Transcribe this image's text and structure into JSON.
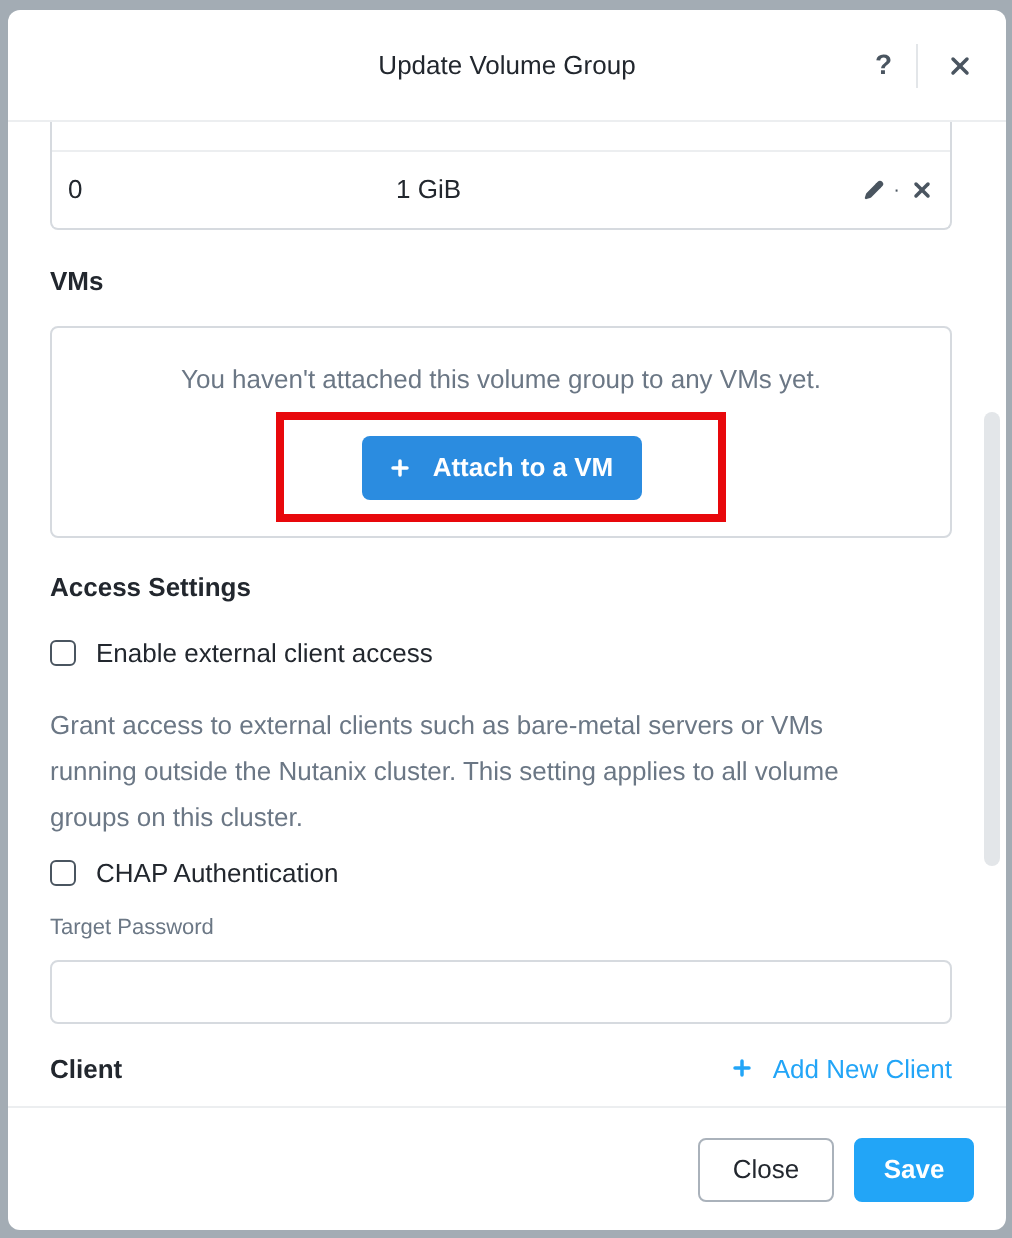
{
  "dialog": {
    "title": "Update Volume Group",
    "help": "?"
  },
  "disks": {
    "rows": [
      {
        "index": "0",
        "size": "1 GiB",
        "separator": "·"
      }
    ]
  },
  "vms": {
    "heading": "VMs",
    "empty_message": "You haven't attached this volume group to any VMs yet.",
    "attach_button": {
      "label": "Attach to a VM",
      "highlighted": true
    }
  },
  "access_settings": {
    "heading": "Access Settings",
    "options": [
      {
        "label": "Enable external client access",
        "checked": false
      },
      {
        "label": "CHAP Authentication",
        "checked": false
      }
    ],
    "description": "Grant access to external clients such as bare-metal servers or VMs running outside the Nutanix cluster. This setting applies to all volume groups on this cluster.",
    "password_label": "Target Password"
  },
  "client": {
    "heading": "Client",
    "add_link": "Add New Client"
  },
  "footer": {
    "buttons": [
      {
        "label": "Close",
        "kind": "secondary"
      },
      {
        "label": "Save",
        "kind": "primary"
      }
    ]
  }
}
